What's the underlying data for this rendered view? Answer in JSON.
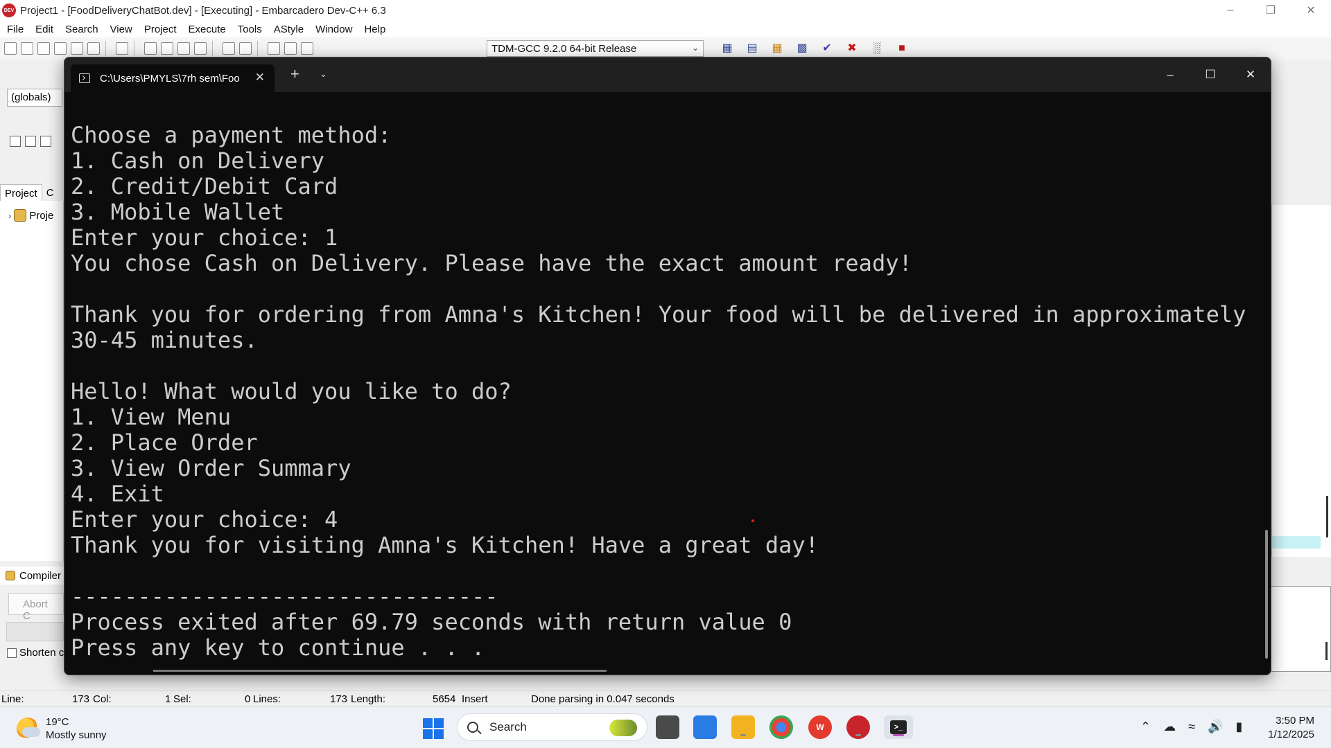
{
  "window": {
    "title": "Project1 - [FoodDeliveryChatBot.dev] - [Executing] - Embarcadero Dev-C++ 6.3",
    "app_icon_text": "DEV"
  },
  "menu": [
    "File",
    "Edit",
    "Search",
    "View",
    "Project",
    "Execute",
    "Tools",
    "AStyle",
    "Window",
    "Help"
  ],
  "toolbar": {
    "compiler": "TDM-GCC 9.2.0 64-bit Release"
  },
  "side": {
    "globals": "(globals)",
    "tab_project": "Project",
    "tab_c": "C",
    "tree_item": "Proje",
    "compiler_tab": "Compiler",
    "abort": "Abort C",
    "shorten": "Shorten c"
  },
  "terminal": {
    "tab_title": "C:\\Users\\PMYLS\\7rh sem\\Foo",
    "lines": [
      "Choose a payment method:",
      "1. Cash on Delivery",
      "2. Credit/Debit Card",
      "3. Mobile Wallet",
      "Enter your choice: 1",
      "You chose Cash on Delivery. Please have the exact amount ready!",
      "",
      "Thank you for ordering from Amna's Kitchen! Your food will be delivered in approximately",
      "30-45 minutes.",
      "",
      "Hello! What would you like to do?",
      "1. View Menu",
      "2. Place Order",
      "3. View Order Summary",
      "4. Exit",
      "Enter your choice: 4",
      "Thank you for visiting Amna's Kitchen! Have a great day!",
      "",
      "--------------------------------",
      "Process exited after 69.79 seconds with return value 0",
      "Press any key to continue . . ."
    ]
  },
  "status": {
    "line_label": "Line:",
    "line_val": "173",
    "col_label": "Col:",
    "col_val": "1",
    "sel_label": "Sel:",
    "sel_val": "0",
    "lines_label": "Lines:",
    "lines_val": "173",
    "length_label": "Length:",
    "length_val": "5654",
    "mode": "Insert",
    "message": "Done parsing in 0.047 seconds"
  },
  "taskbar": {
    "temp": "19°C",
    "weather": "Mostly sunny",
    "search": "Search",
    "time": "3:50 PM",
    "date": "1/12/2025"
  }
}
